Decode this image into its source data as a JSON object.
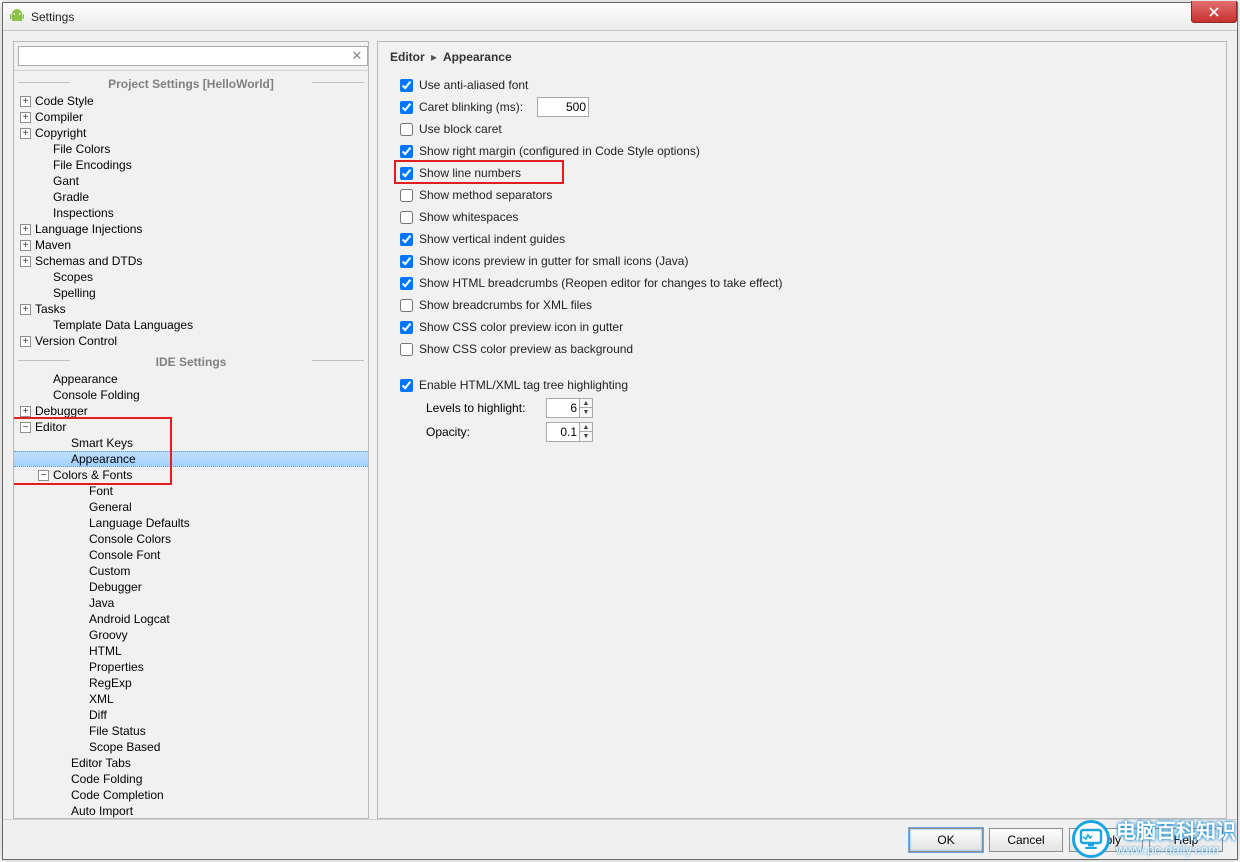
{
  "window": {
    "title": "Settings"
  },
  "search": {
    "placeholder": ""
  },
  "sections": {
    "project": "Project Settings [HelloWorld]",
    "ide": "IDE Settings"
  },
  "project_tree": [
    {
      "label": "Code Style",
      "exp": "+",
      "indent": 0
    },
    {
      "label": "Compiler",
      "exp": "+",
      "indent": 0
    },
    {
      "label": "Copyright",
      "exp": "+",
      "indent": 0
    },
    {
      "label": "File Colors",
      "exp": "",
      "indent": 1
    },
    {
      "label": "File Encodings",
      "exp": "",
      "indent": 1
    },
    {
      "label": "Gant",
      "exp": "",
      "indent": 1
    },
    {
      "label": "Gradle",
      "exp": "",
      "indent": 1
    },
    {
      "label": "Inspections",
      "exp": "",
      "indent": 1
    },
    {
      "label": "Language Injections",
      "exp": "+",
      "indent": 0
    },
    {
      "label": "Maven",
      "exp": "+",
      "indent": 0
    },
    {
      "label": "Schemas and DTDs",
      "exp": "+",
      "indent": 0
    },
    {
      "label": "Scopes",
      "exp": "",
      "indent": 1
    },
    {
      "label": "Spelling",
      "exp": "",
      "indent": 1
    },
    {
      "label": "Tasks",
      "exp": "+",
      "indent": 0
    },
    {
      "label": "Template Data Languages",
      "exp": "",
      "indent": 1
    },
    {
      "label": "Version Control",
      "exp": "+",
      "indent": 0
    }
  ],
  "ide_tree": [
    {
      "label": "Appearance",
      "exp": "",
      "indent": 1
    },
    {
      "label": "Console Folding",
      "exp": "",
      "indent": 1
    },
    {
      "label": "Debugger",
      "exp": "+",
      "indent": 0
    },
    {
      "label": "Editor",
      "exp": "-",
      "indent": 0
    },
    {
      "label": "Smart Keys",
      "exp": "",
      "indent": 2
    },
    {
      "label": "Appearance",
      "exp": "",
      "indent": 2,
      "selected": true
    },
    {
      "label": "Colors & Fonts",
      "exp": "-",
      "indent": 1
    },
    {
      "label": "Font",
      "exp": "",
      "indent": 3
    },
    {
      "label": "General",
      "exp": "",
      "indent": 3
    },
    {
      "label": "Language Defaults",
      "exp": "",
      "indent": 3
    },
    {
      "label": "Console Colors",
      "exp": "",
      "indent": 3
    },
    {
      "label": "Console Font",
      "exp": "",
      "indent": 3
    },
    {
      "label": "Custom",
      "exp": "",
      "indent": 3
    },
    {
      "label": "Debugger",
      "exp": "",
      "indent": 3
    },
    {
      "label": "Java",
      "exp": "",
      "indent": 3
    },
    {
      "label": "Android Logcat",
      "exp": "",
      "indent": 3
    },
    {
      "label": "Groovy",
      "exp": "",
      "indent": 3
    },
    {
      "label": "HTML",
      "exp": "",
      "indent": 3
    },
    {
      "label": "Properties",
      "exp": "",
      "indent": 3
    },
    {
      "label": "RegExp",
      "exp": "",
      "indent": 3
    },
    {
      "label": "XML",
      "exp": "",
      "indent": 3
    },
    {
      "label": "Diff",
      "exp": "",
      "indent": 3
    },
    {
      "label": "File Status",
      "exp": "",
      "indent": 3
    },
    {
      "label": "Scope Based",
      "exp": "",
      "indent": 3
    },
    {
      "label": "Editor Tabs",
      "exp": "",
      "indent": 2
    },
    {
      "label": "Code Folding",
      "exp": "",
      "indent": 2
    },
    {
      "label": "Code Completion",
      "exp": "",
      "indent": 2
    },
    {
      "label": "Auto Import",
      "exp": "",
      "indent": 2
    }
  ],
  "breadcrumb": {
    "root": "Editor",
    "leaf": "Appearance"
  },
  "options": [
    {
      "label": "Use anti-aliased font",
      "checked": true
    },
    {
      "label": "Caret blinking (ms):",
      "checked": true,
      "input": "500"
    },
    {
      "label": "Use block caret",
      "checked": false
    },
    {
      "label": "Show right margin (configured in Code Style options)",
      "checked": true
    },
    {
      "label": "Show line numbers",
      "checked": true,
      "highlighted": true
    },
    {
      "label": "Show method separators",
      "checked": false
    },
    {
      "label": "Show whitespaces",
      "checked": false
    },
    {
      "label": "Show vertical indent guides",
      "checked": true
    },
    {
      "label": "Show icons preview in gutter for small icons (Java)",
      "checked": true
    },
    {
      "label": "Show HTML breadcrumbs (Reopen editor for changes to take effect)",
      "checked": true
    },
    {
      "label": "Show breadcrumbs for XML files",
      "checked": false
    },
    {
      "label": "Show CSS color preview icon in gutter",
      "checked": true
    },
    {
      "label": "Show CSS color preview as background",
      "checked": false
    }
  ],
  "enable_html": {
    "label": "Enable HTML/XML tag tree highlighting",
    "checked": true,
    "levels_label": "Levels to highlight:",
    "levels_value": "6",
    "opacity_label": "Opacity:",
    "opacity_value": "0.1"
  },
  "buttons": {
    "ok": "OK",
    "cancel": "Cancel",
    "apply": "Apply",
    "help": "Help"
  },
  "watermark": {
    "line1": "电脑百科知识",
    "line2": "www.pc-daily.com"
  }
}
